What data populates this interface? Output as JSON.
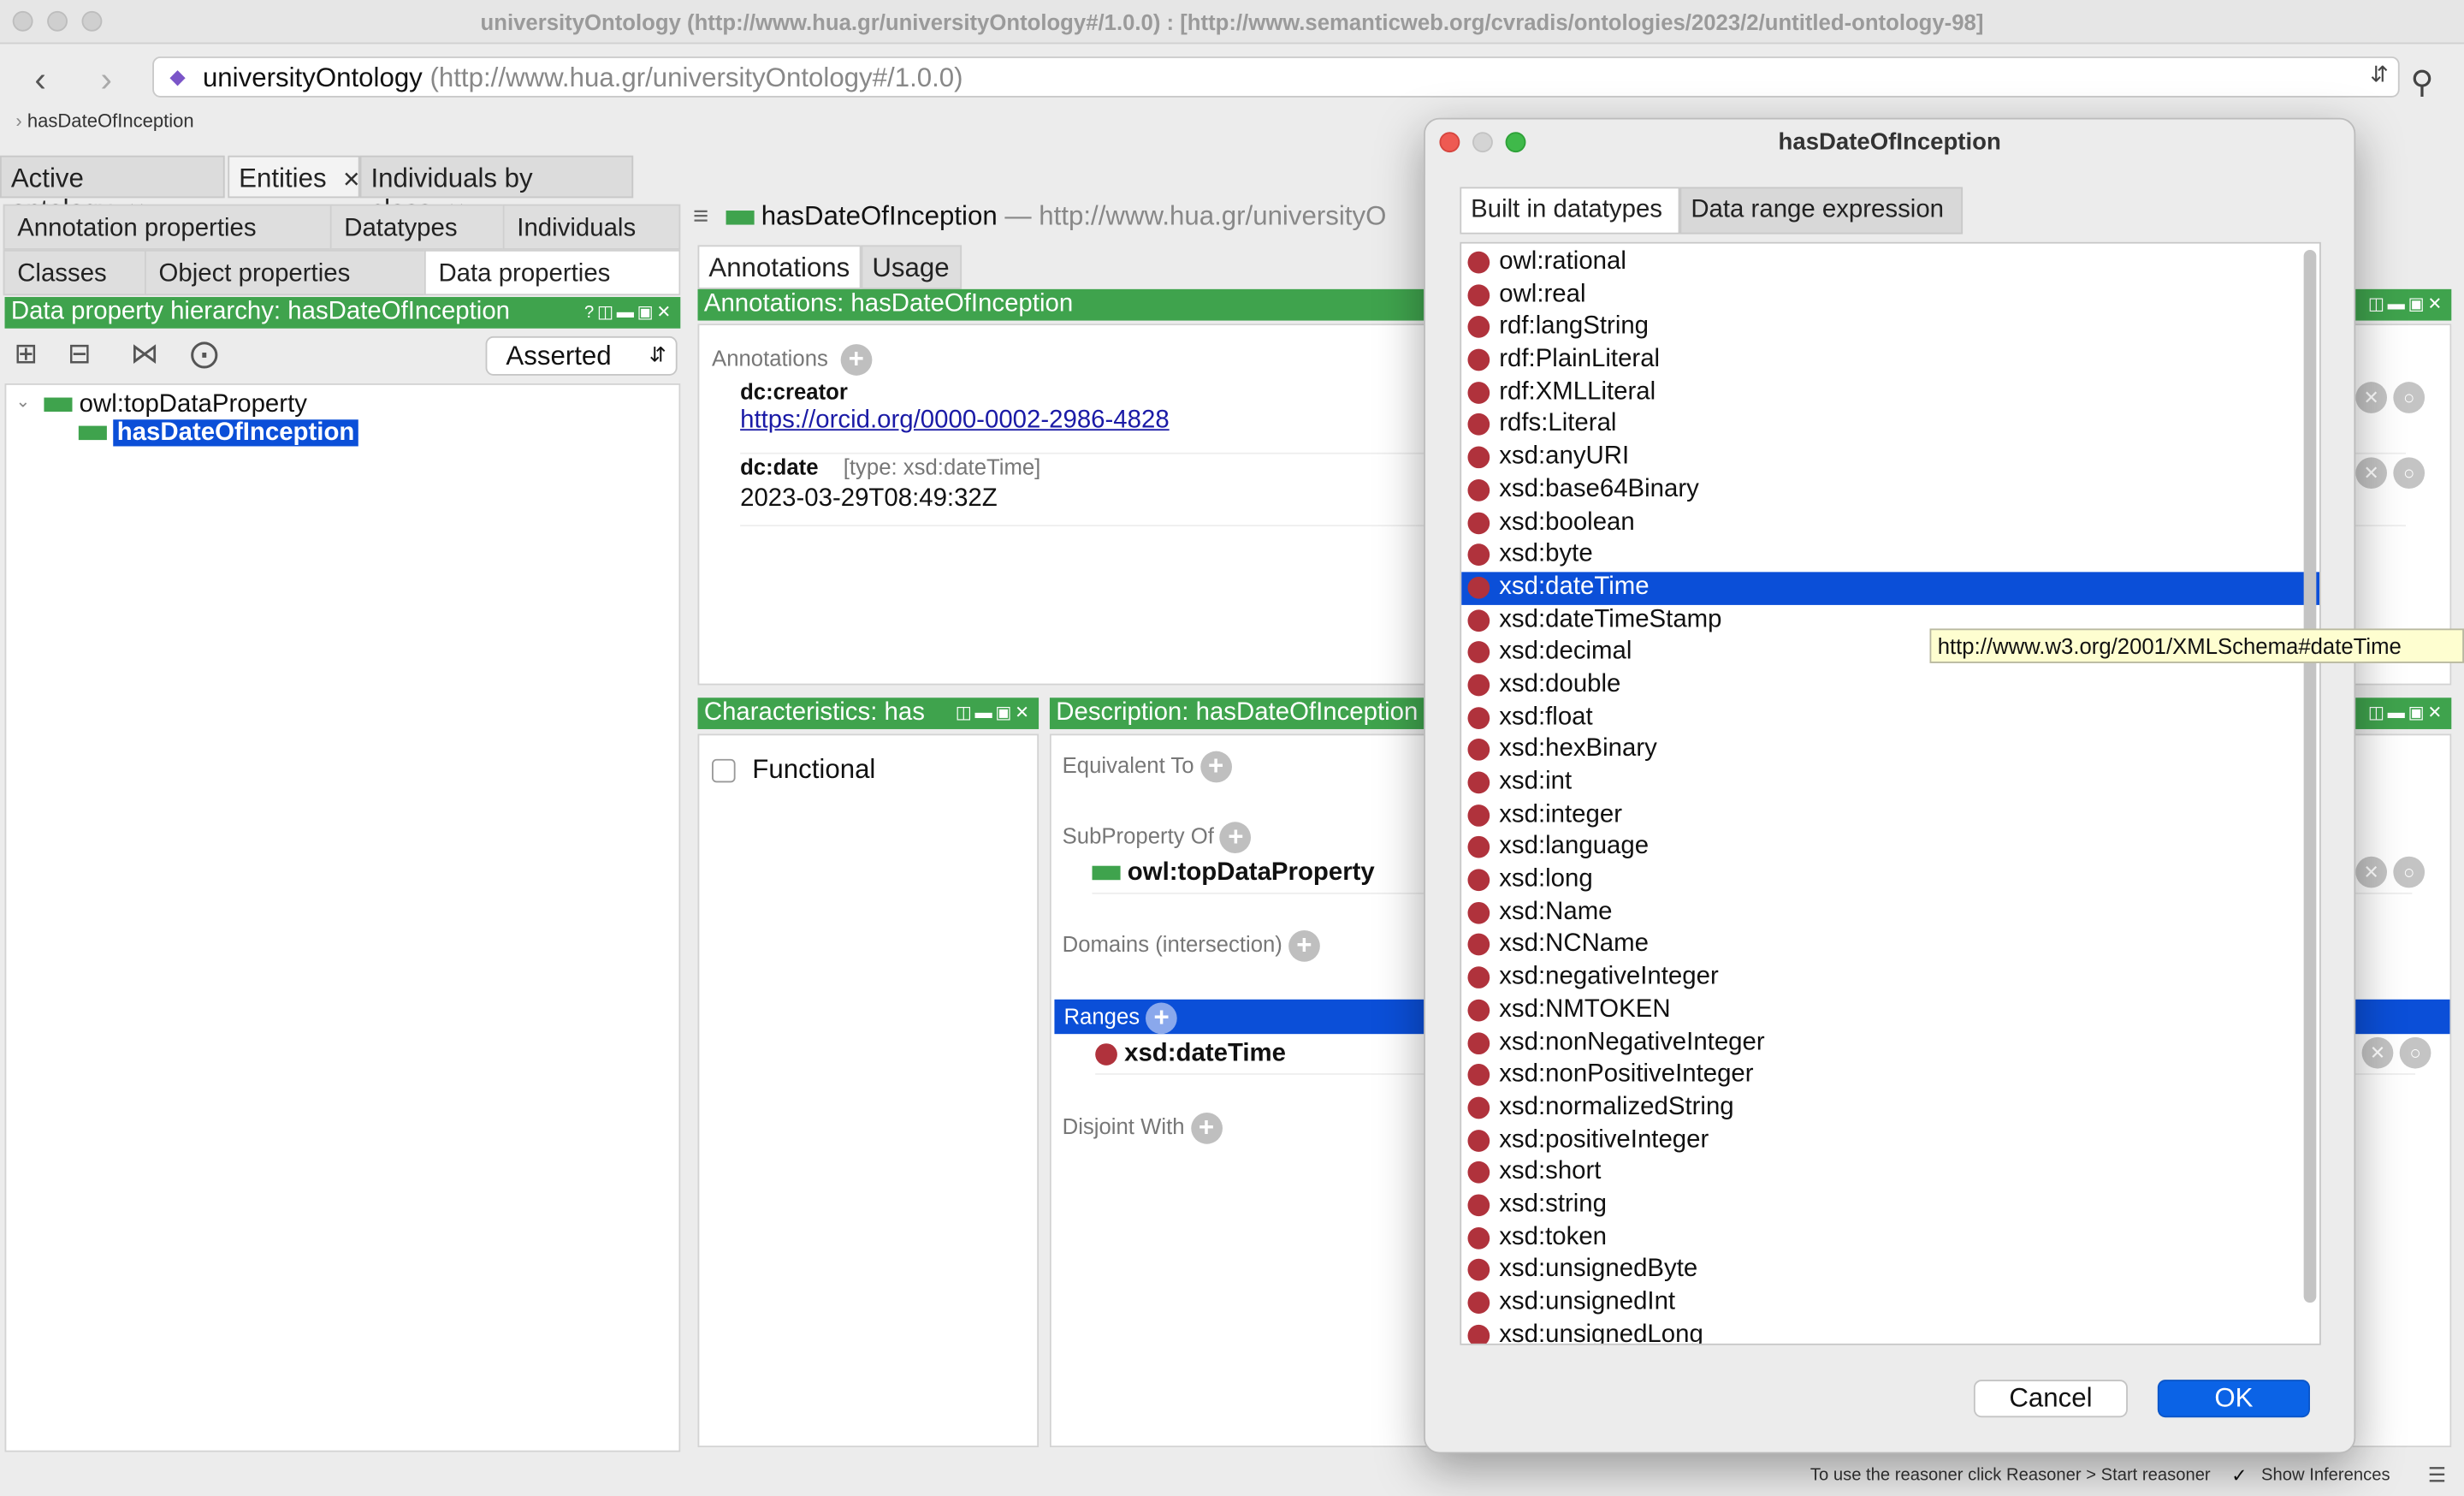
{
  "window": {
    "title": "universityOntology (http://www.hua.gr/universityOntology#/1.0.0)  : [http://www.semanticweb.org/cvradis/ontologies/2023/2/untitled-ontology-98]"
  },
  "address": {
    "ontology_name": "universityOntology",
    "ontology_iri": "(http://www.hua.gr/universityOntology#/1.0.0)"
  },
  "breadcrumb": "hasDateOfInception",
  "tabs": [
    {
      "label": "Active ontology"
    },
    {
      "label": "Entities"
    },
    {
      "label": "Individuals by class"
    }
  ],
  "entity_tabs": {
    "annotation_properties": "Annotation properties",
    "datatypes": "Datatypes",
    "individuals": "Individuals",
    "classes": "Classes",
    "object_properties": "Object properties",
    "data_properties": "Data properties"
  },
  "hierarchy": {
    "header": "Data property hierarchy: hasDateOfInception",
    "mode": "Asserted",
    "root": "owl:topDataProperty",
    "child": "hasDateOfInception"
  },
  "entity_header": {
    "name": "hasDateOfInception",
    "iri": "— http://www.hua.gr/universityO"
  },
  "annotations_tabs": {
    "annotations": "Annotations",
    "usage": "Usage"
  },
  "annotations": {
    "header": "Annotations: hasDateOfInception",
    "section_label": "Annotations",
    "items": [
      {
        "property": "dc:creator",
        "type": "",
        "value": "https://orcid.org/0000-0002-2986-4828"
      },
      {
        "property": "dc:date",
        "type": "[type: xsd:dateTime]",
        "value": "2023-03-29T08:49:32Z"
      }
    ]
  },
  "characteristics": {
    "header": "Characteristics: has",
    "functional_label": "Functional",
    "functional_checked": false
  },
  "description": {
    "header": "Description: hasDateOfInception",
    "equivalent_to": "Equivalent To",
    "subproperty_of": "SubProperty Of",
    "subproperty_value": "owl:topDataProperty",
    "domains": "Domains (intersection)",
    "ranges": "Ranges",
    "range_value": "xsd:dateTime",
    "disjoint_with": "Disjoint With"
  },
  "dialog": {
    "title": "hasDateOfInception",
    "tab_builtin": "Built in datatypes",
    "tab_expression": "Data range expression",
    "datatypes": [
      "owl:rational",
      "owl:real",
      "rdf:langString",
      "rdf:PlainLiteral",
      "rdf:XMLLiteral",
      "rdfs:Literal",
      "xsd:anyURI",
      "xsd:base64Binary",
      "xsd:boolean",
      "xsd:byte",
      "xsd:dateTime",
      "xsd:dateTimeStamp",
      "xsd:decimal",
      "xsd:double",
      "xsd:float",
      "xsd:hexBinary",
      "xsd:int",
      "xsd:integer",
      "xsd:language",
      "xsd:long",
      "xsd:Name",
      "xsd:NCName",
      "xsd:negativeInteger",
      "xsd:NMTOKEN",
      "xsd:nonNegativeInteger",
      "xsd:nonPositiveInteger",
      "xsd:normalizedString",
      "xsd:positiveInteger",
      "xsd:short",
      "xsd:string",
      "xsd:token",
      "xsd:unsignedByte",
      "xsd:unsignedInt",
      "xsd:unsignedLong"
    ],
    "selected": "xsd:dateTime",
    "cancel": "Cancel",
    "ok": "OK"
  },
  "tooltip": "http://www.w3.org/2001/XMLSchema#dateTime",
  "status": {
    "reasoner_hint": "To use the reasoner click Reasoner > Start reasoner",
    "show_inferences": "Show Inferences",
    "show_inferences_checked": true
  },
  "colors": {
    "green_header": "#3fa34d",
    "selection_blue": "#0b4fd8",
    "datatype_dot": "#b0323c",
    "link": "#1a1aa6",
    "tooltip_bg": "#fefed0"
  }
}
